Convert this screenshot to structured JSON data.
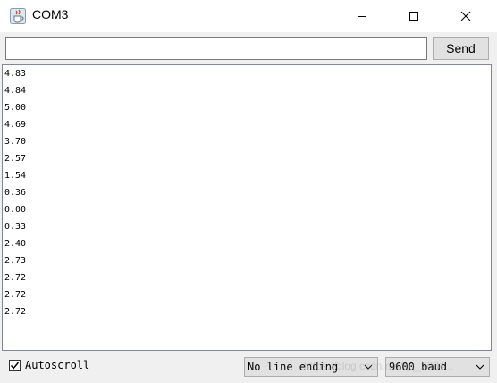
{
  "window": {
    "title": "COM3",
    "icon": "java-cup-icon"
  },
  "input": {
    "value": "",
    "placeholder": ""
  },
  "toolbar": {
    "send_label": "Send"
  },
  "output": {
    "lines": [
      "4.83",
      "4.84",
      "5.00",
      "4.69",
      "3.70",
      "2.57",
      "1.54",
      "0.36",
      "0.00",
      "0.33",
      "2.40",
      "2.73",
      "2.72",
      "2.72",
      "2.72"
    ]
  },
  "bottom": {
    "autoscroll_label": "Autoscroll",
    "autoscroll_checked": true,
    "line_ending": "No line ending",
    "baud_rate": "9600 baud"
  },
  "watermark": "https://blog.csdn.net/qq_2034..."
}
